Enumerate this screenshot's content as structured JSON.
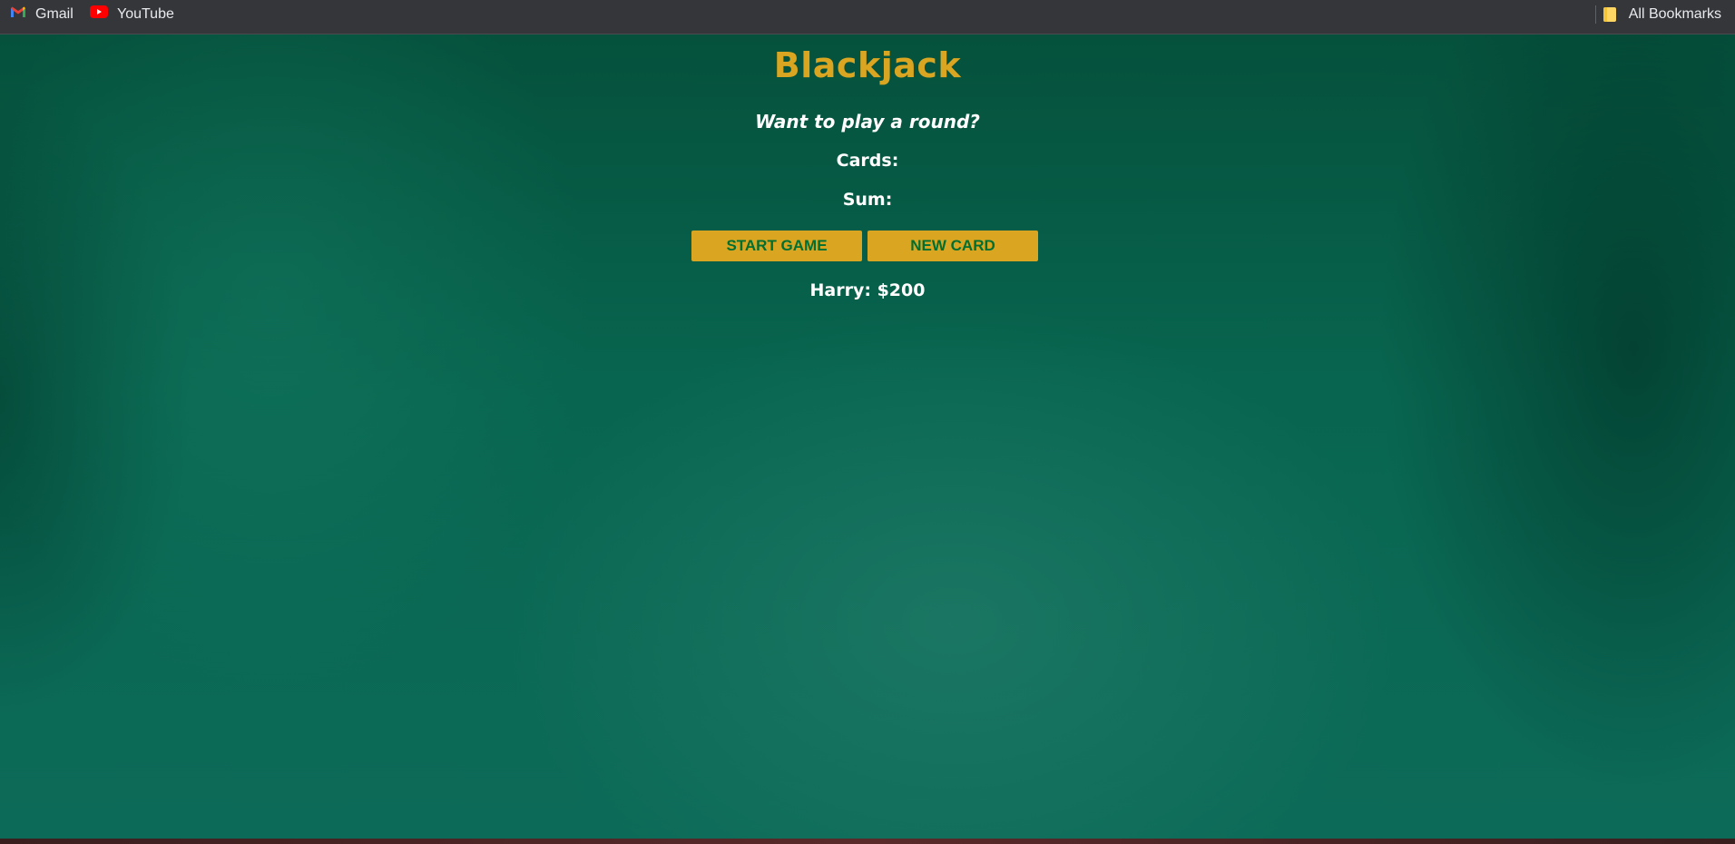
{
  "bookmarks": {
    "gmail": "Gmail",
    "youtube": "YouTube",
    "all": "All Bookmarks"
  },
  "game": {
    "title": "Blackjack",
    "message": "Want to play a round?",
    "cards_label": "Cards:",
    "sum_label": "Sum:",
    "start_button": "START GAME",
    "new_card_button": "NEW CARD",
    "player": "Harry: $200"
  },
  "colors": {
    "accent": "#daa520",
    "button_text": "#016f32",
    "table_green": "#086650"
  },
  "icons": {
    "gmail": "gmail-icon",
    "youtube": "youtube-icon",
    "folder": "folder-icon"
  }
}
